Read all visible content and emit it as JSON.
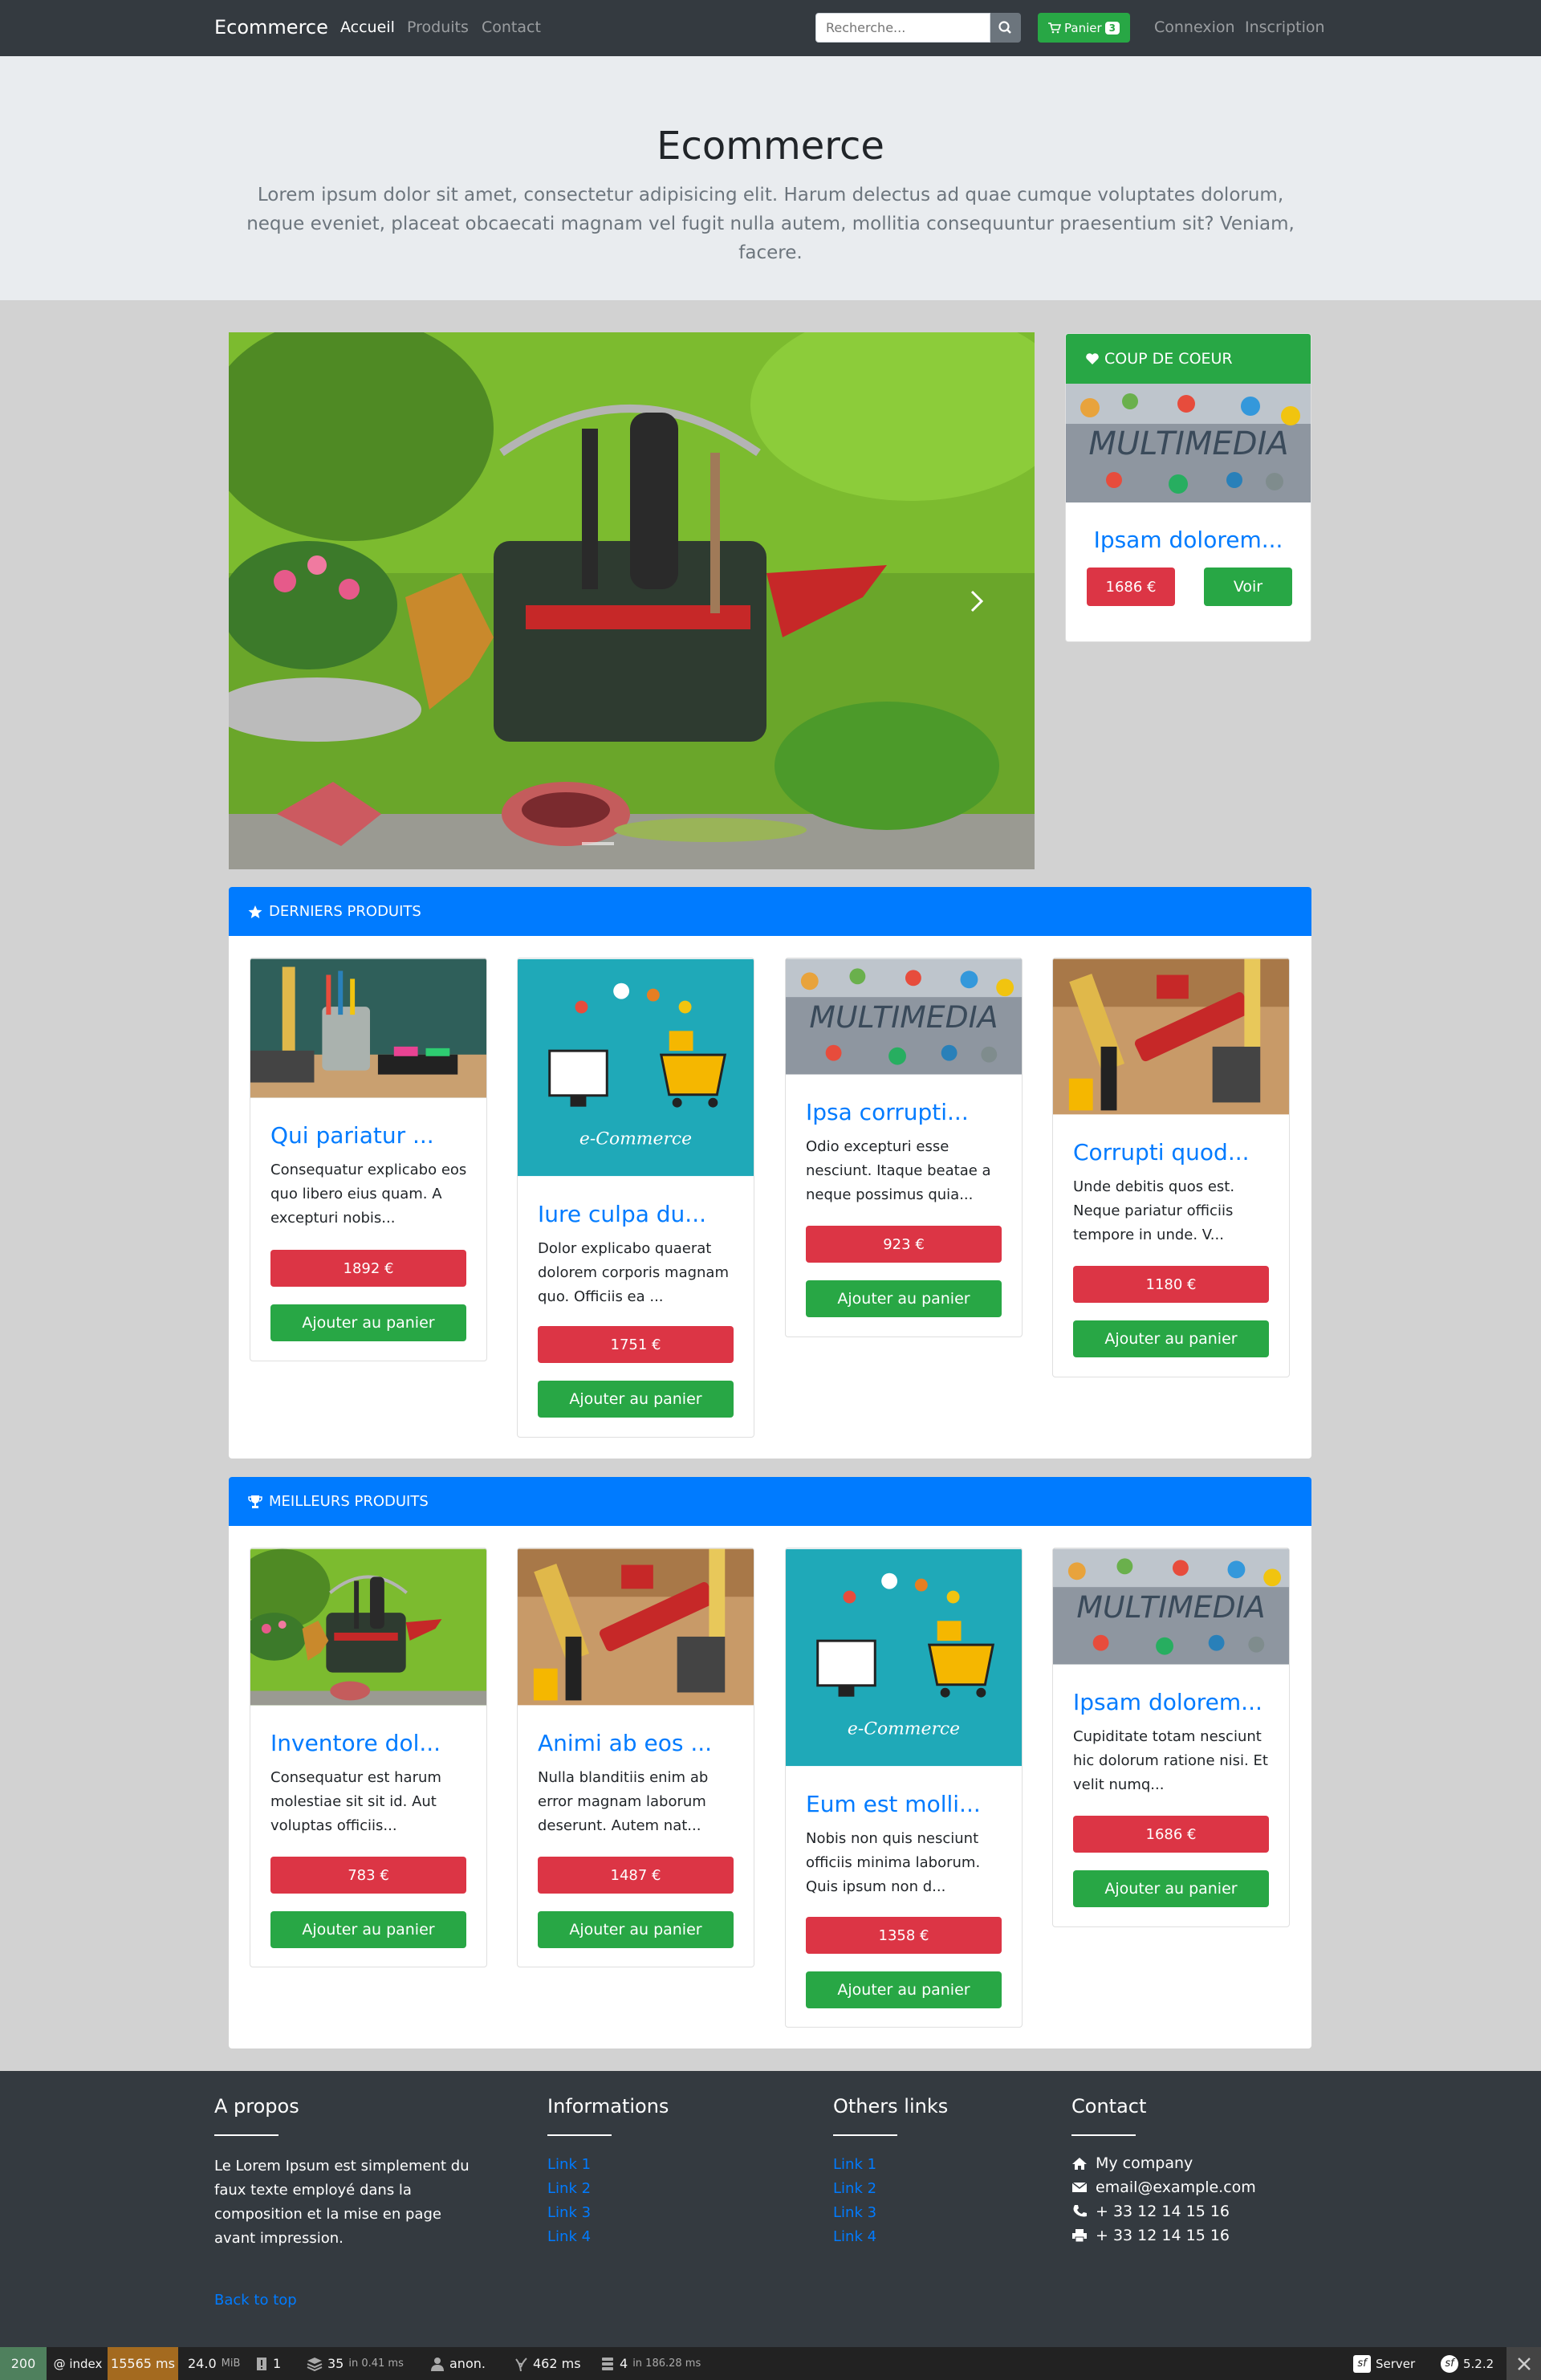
{
  "navbar": {
    "brand": "Ecommerce",
    "links": [
      "Accueil",
      "Produits",
      "Contact"
    ],
    "search_placeholder": "Recherche...",
    "cart_label": "Panier",
    "cart_count": "3",
    "auth_links": [
      "Connexion",
      "Inscription"
    ]
  },
  "jumbotron": {
    "title": "Ecommerce",
    "lead": "Lorem ipsum dolor sit amet, consectetur adipisicing elit. Harum delectus ad quae cumque voluptates dolorum, neque eveniet, placeat obcaecati magnam vel fugit nulla autem, mollitia consequuntur praesentium sit? Veniam, facere."
  },
  "coup_de_coeur": {
    "header": "COUP DE COEUR",
    "title": "Ipsam dolorem...",
    "price": "1686 €",
    "button": "Voir"
  },
  "derniers": {
    "header": "DERNIERS PRODUITS",
    "products": [
      {
        "title": "Qui pariatur ...",
        "desc": "Consequatur explicabo eos quo libero eius quam. A excepturi nobis...",
        "price": "1892 €",
        "button": "Ajouter au panier"
      },
      {
        "title": "Iure culpa du...",
        "desc": "Dolor explicabo quaerat dolorem corporis magnam quo. Officiis ea ...",
        "price": "1751 €",
        "button": "Ajouter au panier"
      },
      {
        "title": "Ipsa corrupti...",
        "desc": "Odio excepturi esse nesciunt. Itaque beatae a neque possimus quia...",
        "price": "923 €",
        "button": "Ajouter au panier"
      },
      {
        "title": "Corrupti quod...",
        "desc": "Unde debitis quos est. Neque pariatur officiis tempore in unde. V...",
        "price": "1180 €",
        "button": "Ajouter au panier"
      }
    ]
  },
  "meilleurs": {
    "header": "MEILLEURS PRODUITS",
    "products": [
      {
        "title": "Inventore dol...",
        "desc": "Consequatur est harum molestiae sit sit id. Aut voluptas officiis...",
        "price": "783 €",
        "button": "Ajouter au panier"
      },
      {
        "title": "Animi ab eos ...",
        "desc": "Nulla blanditiis enim ab error magnam laborum deserunt. Autem nat...",
        "price": "1487 €",
        "button": "Ajouter au panier"
      },
      {
        "title": "Eum est molli...",
        "desc": "Nobis non quis nesciunt officiis minima laborum. Quis ipsum non d...",
        "price": "1358 €",
        "button": "Ajouter au panier"
      },
      {
        "title": "Ipsam dolorem...",
        "desc": "Cupiditate totam nesciunt hic dolorum ratione nisi. Et velit numq...",
        "price": "1686 €",
        "button": "Ajouter au panier"
      }
    ]
  },
  "footer": {
    "about_title": "A propos",
    "about_text": "Le Lorem Ipsum est simplement du faux texte employé dans la composition et la mise en page avant impression.",
    "info_title": "Informations",
    "info_links": [
      "Link 1",
      "Link 2",
      "Link 3",
      "Link 4"
    ],
    "others_title": "Others links",
    "others_links": [
      "Link 1",
      "Link 2",
      "Link 3",
      "Link 4"
    ],
    "contact_title": "Contact",
    "contact_company": "My company",
    "contact_email": "email@example.com",
    "contact_phone": "+ 33 12 14 15 16",
    "contact_fax": "+ 33 12 14 15 16",
    "back_to_top": "Back to top"
  },
  "debugbar": {
    "status": "200",
    "route": "@ index",
    "time": "15565 ms",
    "memory": "24.0",
    "memory_unit": "MiB",
    "logs": "1",
    "cache": "35",
    "cache_suffix": "in 0.41 ms",
    "user": "anon.",
    "twig": "462 ms",
    "db": "4",
    "db_suffix": "in 186.28 ms",
    "server": "Server",
    "version": "5.2.2"
  }
}
